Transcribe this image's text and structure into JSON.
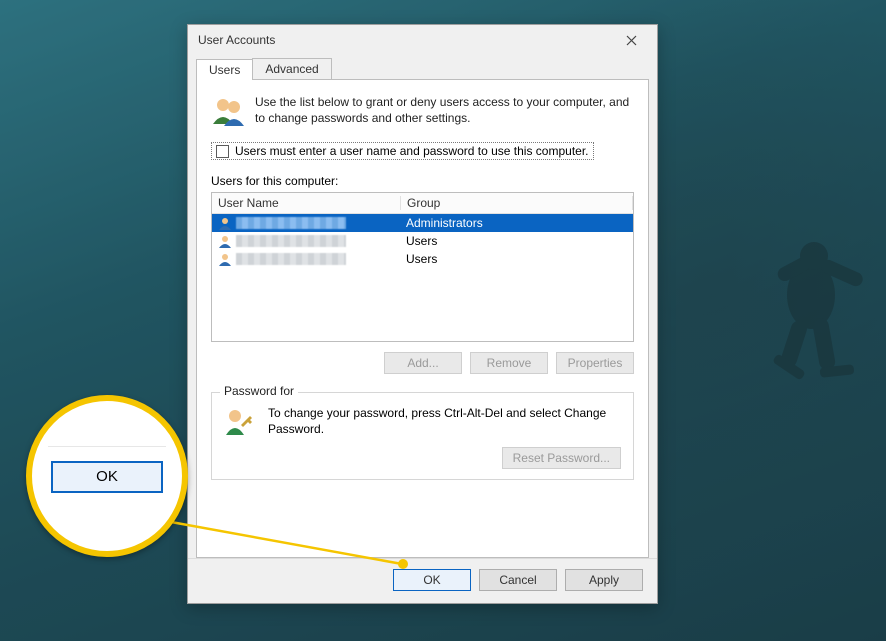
{
  "dialog": {
    "title": "User Accounts",
    "close_aria": "Close",
    "tabs": {
      "users": "Users",
      "advanced": "Advanced"
    },
    "intro_text": "Use the list below to grant or deny users access to your computer, and to change passwords and other settings.",
    "checkbox_label": "Users must enter a user name and password to use this computer.",
    "checkbox_checked": false,
    "list_label": "Users for this computer:",
    "columns": {
      "name": "User Name",
      "group": "Group"
    },
    "rows": [
      {
        "name": "",
        "group": "Administrators",
        "selected": true
      },
      {
        "name": "",
        "group": "Users",
        "selected": false
      },
      {
        "name": "",
        "group": "Users",
        "selected": false
      }
    ],
    "buttons": {
      "add": "Add...",
      "remove": "Remove",
      "properties": "Properties"
    },
    "password": {
      "legend": "Password for",
      "text": "To change your password, press Ctrl-Alt-Del and select Change Password.",
      "reset": "Reset Password..."
    },
    "footer": {
      "ok": "OK",
      "cancel": "Cancel",
      "apply": "Apply"
    }
  },
  "callout": {
    "ok": "OK"
  }
}
